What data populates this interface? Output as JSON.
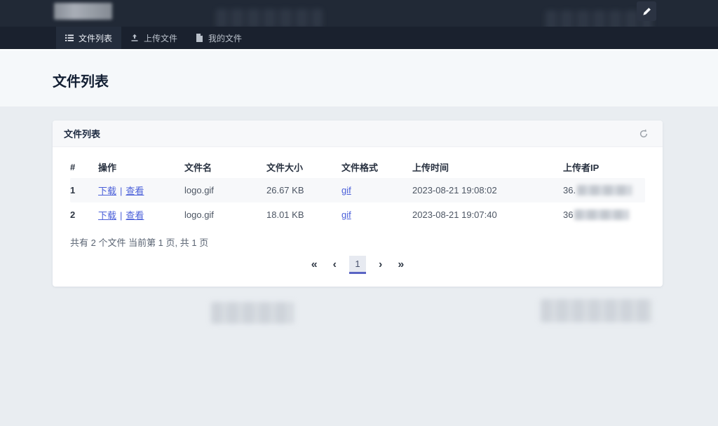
{
  "topbar": {
    "edit_button_icon": "pencil-icon",
    "logo": "blurred-logo"
  },
  "nav": {
    "tabs": [
      {
        "label": "文件列表",
        "icon": "list-icon",
        "active": true
      },
      {
        "label": "上传文件",
        "icon": "upload-icon",
        "active": false
      },
      {
        "label": "我的文件",
        "icon": "document-icon",
        "active": false
      }
    ]
  },
  "page": {
    "title": "文件列表"
  },
  "card": {
    "title": "文件列表",
    "refresh_icon": "refresh-icon",
    "table": {
      "columns": [
        "#",
        "操作",
        "文件名",
        "文件大小",
        "文件格式",
        "上传时间",
        "上传者IP"
      ],
      "action_separator": "|",
      "rows": [
        {
          "index": "1",
          "action_download": "下载",
          "action_view": "查看",
          "filename": "logo.gif",
          "size": "26.67 KB",
          "format": "gif",
          "time": "2023-08-21 19:08:02",
          "ip_visible": "36."
        },
        {
          "index": "2",
          "action_download": "下载",
          "action_view": "查看",
          "filename": "logo.gif",
          "size": "18.01 KB",
          "format": "gif",
          "time": "2023-08-21 19:07:40",
          "ip_visible": "36"
        }
      ]
    },
    "summary": "共有 2 个文件  当前第 1 页, 共 1 页",
    "pagination": {
      "first": "«",
      "prev": "‹",
      "current": "1",
      "next": "›",
      "last": "»"
    }
  },
  "colors": {
    "topbar": "#212936",
    "navbar": "#1a212e",
    "active_tab": "#242d3c",
    "link": "#4a5fd9",
    "pagination_underline": "#5a64c4",
    "hero_bg": "#f5f8fa",
    "body_bg": "#e9edf1",
    "row_stripe": "#f7f8fa"
  }
}
